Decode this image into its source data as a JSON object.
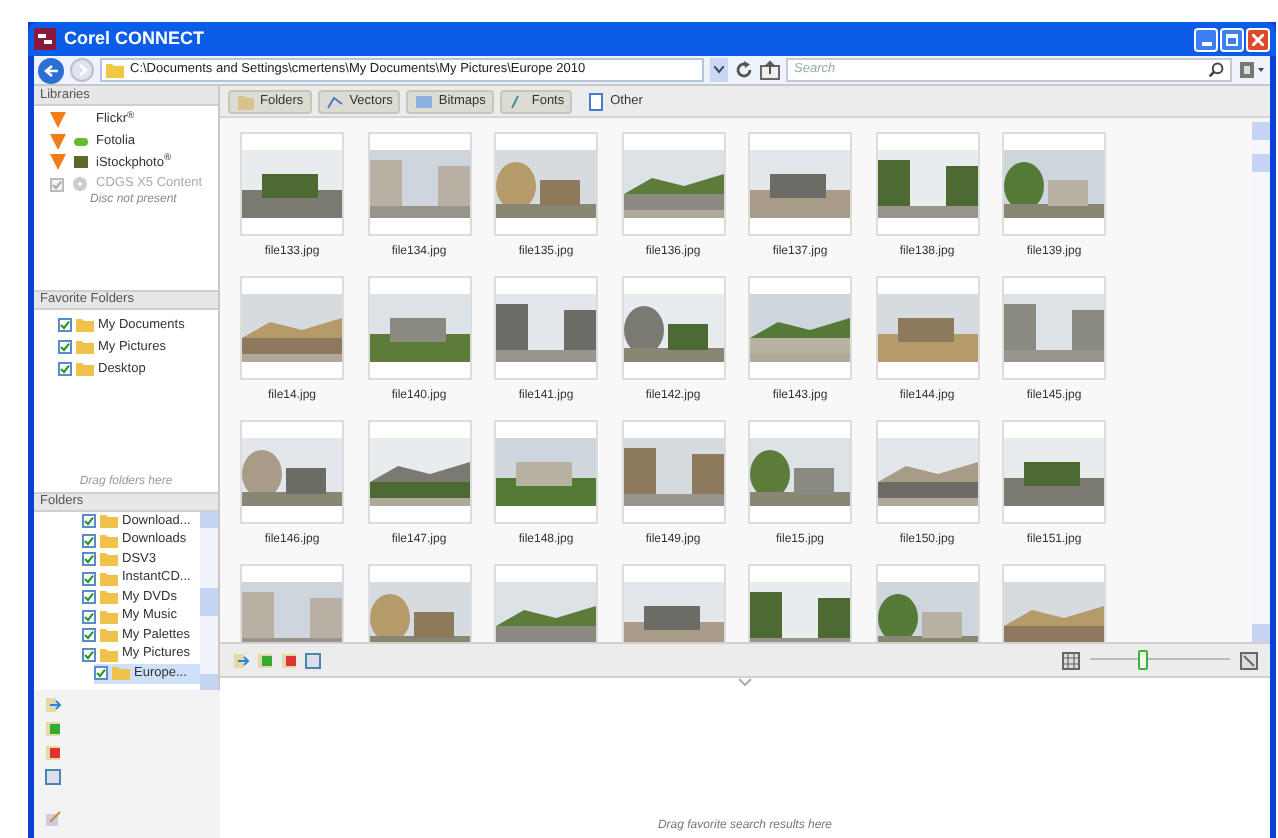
{
  "window": {
    "title": "Corel CONNECT"
  },
  "address": {
    "path": "C:\\Documents and Settings\\cmertens\\My Documents\\My Pictures\\Europe 2010",
    "search_placeholder": "Search"
  },
  "libraries": {
    "title": "Libraries",
    "items": [
      {
        "label": "Flickr$^{®}$",
        "kind": "online",
        "disabled": false
      },
      {
        "label": "Fotolia",
        "kind": "online",
        "disabled": false
      },
      {
        "label": "iStockphoto$^{®}$",
        "kind": "online",
        "disabled": false
      },
      {
        "label": "CDGS X5 Content",
        "kind": "disc",
        "disabled": true,
        "note": "Disc not present"
      }
    ]
  },
  "favorite_folders": {
    "title": "Favorite Folders",
    "hint": "Drag folders here",
    "items": [
      {
        "label": "My Documents",
        "checked": true
      },
      {
        "label": "My Pictures",
        "checked": true
      },
      {
        "label": "Desktop",
        "checked": true
      }
    ]
  },
  "folders": {
    "title": "Folders",
    "items": [
      {
        "label": "Download...",
        "checked": true,
        "selected": false
      },
      {
        "label": "Downloads",
        "checked": true,
        "selected": false
      },
      {
        "label": "DSV3",
        "checked": true,
        "selected": false
      },
      {
        "label": "InstantCD...",
        "checked": true,
        "selected": false
      },
      {
        "label": "My DVDs",
        "checked": true,
        "selected": false
      },
      {
        "label": "My Music",
        "checked": true,
        "selected": false
      },
      {
        "label": "My Palettes",
        "checked": true,
        "selected": false
      },
      {
        "label": "My Pictures",
        "checked": true,
        "selected": false,
        "children": [
          {
            "label": "Europe...",
            "checked": true,
            "selected": true
          }
        ]
      }
    ]
  },
  "filter_tabs": [
    {
      "label": "Folders",
      "pressed": true
    },
    {
      "label": "Vectors",
      "pressed": true
    },
    {
      "label": "Bitmaps",
      "pressed": true
    },
    {
      "label": "Fonts",
      "pressed": true
    },
    {
      "label": "Other",
      "pressed": false
    }
  ],
  "thumbnails": [
    {
      "label": "file133.jpg",
      "kind": "picture"
    },
    {
      "label": "file134.jpg",
      "kind": "picture"
    },
    {
      "label": "file135.jpg",
      "kind": "picture"
    },
    {
      "label": "file136.jpg",
      "kind": "picture"
    },
    {
      "label": "file137.jpg",
      "kind": "picture"
    },
    {
      "label": "file138.jpg",
      "kind": "picture"
    },
    {
      "label": "file139.jpg",
      "kind": "picture"
    },
    {
      "label": "file14.jpg",
      "kind": "picture"
    },
    {
      "label": "file140.jpg",
      "kind": "picture"
    },
    {
      "label": "file141.jpg",
      "kind": "picture"
    },
    {
      "label": "file142.jpg",
      "kind": "picture"
    },
    {
      "label": "file143.jpg",
      "kind": "picture"
    },
    {
      "label": "file144.jpg",
      "kind": "picture"
    },
    {
      "label": "file145.jpg",
      "kind": "picture"
    },
    {
      "label": "file146.jpg",
      "kind": "picture"
    },
    {
      "label": "file147.jpg",
      "kind": "picture"
    },
    {
      "label": "file148.jpg",
      "kind": "picture"
    },
    {
      "label": "file149.jpg",
      "kind": "picture"
    },
    {
      "label": "file15.jpg",
      "kind": "picture"
    },
    {
      "label": "file150.jpg",
      "kind": "picture"
    },
    {
      "label": "file151.jpg",
      "kind": "picture"
    },
    {
      "kind": "picture"
    },
    {
      "kind": "picture"
    },
    {
      "kind": "picture"
    },
    {
      "kind": "picture"
    },
    {
      "kind": "picture"
    },
    {
      "kind": "picture"
    },
    {
      "kind": "picture"
    }
  ],
  "zoom_slider": {
    "level": 0.37
  },
  "tray": {
    "hint": "Drag favorite search results here"
  }
}
